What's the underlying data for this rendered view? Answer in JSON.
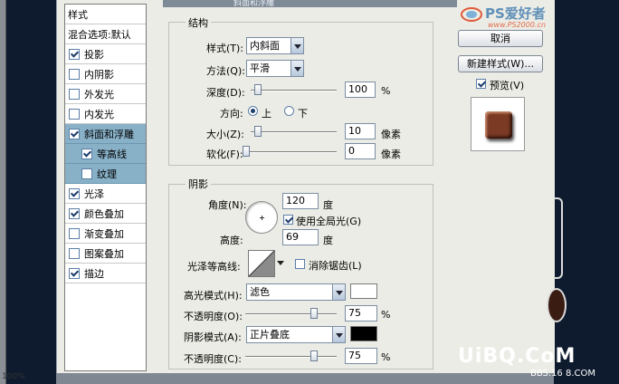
{
  "dialog": {
    "title": "斜面和浮雕"
  },
  "watermarks": {
    "top": "PS爱好者",
    "top_url": "www.PS2000.cn",
    "bottom_logo": "UiBQ.CoM",
    "bottom_text": "BBS.16 8.COM",
    "corner_text": "100%"
  },
  "styles_panel": {
    "header": "样式",
    "items": [
      {
        "label": "混合选项:默认",
        "checkbox": false,
        "checked": false,
        "selected": false,
        "sub": false
      },
      {
        "label": "投影",
        "checkbox": true,
        "checked": true,
        "selected": false,
        "sub": false
      },
      {
        "label": "内阴影",
        "checkbox": true,
        "checked": false,
        "selected": false,
        "sub": false
      },
      {
        "label": "外发光",
        "checkbox": true,
        "checked": false,
        "selected": false,
        "sub": false
      },
      {
        "label": "内发光",
        "checkbox": true,
        "checked": false,
        "selected": false,
        "sub": false
      },
      {
        "label": "斜面和浮雕",
        "checkbox": true,
        "checked": true,
        "selected": true,
        "sub": false
      },
      {
        "label": "等高线",
        "checkbox": true,
        "checked": true,
        "selected": true,
        "sub": true
      },
      {
        "label": "纹理",
        "checkbox": true,
        "checked": false,
        "selected": true,
        "sub": true
      },
      {
        "label": "光泽",
        "checkbox": true,
        "checked": true,
        "selected": false,
        "sub": false
      },
      {
        "label": "颜色叠加",
        "checkbox": true,
        "checked": true,
        "selected": false,
        "sub": false
      },
      {
        "label": "渐变叠加",
        "checkbox": true,
        "checked": false,
        "selected": false,
        "sub": false
      },
      {
        "label": "图案叠加",
        "checkbox": true,
        "checked": false,
        "selected": false,
        "sub": false
      },
      {
        "label": "描边",
        "checkbox": true,
        "checked": true,
        "selected": false,
        "sub": false
      }
    ]
  },
  "structure": {
    "title": "结构",
    "style_label": "样式(T):",
    "style_value": "内斜面",
    "technique_label": "方法(Q):",
    "technique_value": "平滑",
    "depth_label": "深度(D):",
    "depth_value": "100",
    "depth_unit": "%",
    "direction_label": "方向:",
    "direction_up": "上",
    "direction_down": "下",
    "size_label": "大小(Z):",
    "size_value": "10",
    "size_unit": "像素",
    "soften_label": "软化(F):",
    "soften_value": "0",
    "soften_unit": "像素"
  },
  "shading": {
    "title": "阴影",
    "angle_label": "角度(N):",
    "angle_value": "120",
    "angle_unit": "度",
    "global_light_label": "使用全局光(G)",
    "altitude_label": "高度:",
    "altitude_value": "69",
    "altitude_unit": "度",
    "gloss_contour_label": "光泽等高线:",
    "anti_alias_label": "消除锯齿(L)",
    "highlight_mode_label": "高光模式(H):",
    "highlight_mode_value": "滤色",
    "highlight_opacity_label": "不透明度(O):",
    "highlight_opacity_value": "75",
    "highlight_opacity_unit": "%",
    "shadow_mode_label": "阴影模式(A):",
    "shadow_mode_value": "正片叠底",
    "shadow_opacity_label": "不透明度(C):",
    "shadow_opacity_value": "75",
    "shadow_opacity_unit": "%"
  },
  "right_buttons": {
    "cancel": "取消",
    "new_style": "新建样式(W)...",
    "preview": "预览(V)"
  },
  "colors": {
    "highlight_color": "#ffffff",
    "shadow_color": "#000000",
    "selected_row": "#88b1c8"
  }
}
